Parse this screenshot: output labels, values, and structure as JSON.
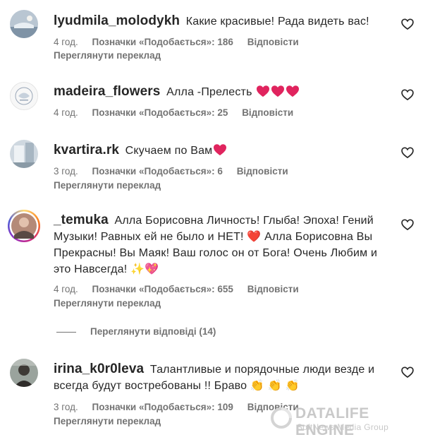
{
  "comments": [
    {
      "username": "lyudmila_molodykh",
      "text": "Какие красивые! Рада видеть вас!",
      "emojis": [],
      "time": "4 год.",
      "likes": "Позначки «Подобається»: 186",
      "reply": "Відповісти",
      "translation": "Переглянути переклад"
    },
    {
      "username": "madeira_flowers",
      "text": "Алла -Прелесть",
      "emojis": [
        "red-heart",
        "red-heart",
        "red-heart"
      ],
      "time": "4 год.",
      "likes": "Позначки «Подобається»: 25",
      "reply": "Відповісти",
      "translation": ""
    },
    {
      "username": "kvartira.rk",
      "text": "Скучаем по Вам",
      "emojis": [
        "red-heart"
      ],
      "time": "3 год.",
      "likes": "Позначки «Подобається»: 6",
      "reply": "Відповісти",
      "translation": "Переглянути переклад"
    },
    {
      "username": "_temuka",
      "text": "Алла Борисовна Личность! Глыба! Эпоха! Гений Музыки! Равных ей не было и НЕТ! ❤️ Алла Борисовна Вы Прекрасны! Вы Маяк! Ваш голос он от Бога! Очень Любим и это Навсегда! ✨💖",
      "emojis": [],
      "time": "4 год.",
      "likes": "Позначки «Подобається»: 655",
      "reply": "Відповісти",
      "translation": "Переглянути переклад"
    },
    {
      "username": "irina_k0r0leva",
      "text": "Талантливые и порядочные люди везде и всегда будут востребованы !! Браво 👏 👏 👏",
      "emojis": [],
      "time": "3 год.",
      "likes": "Позначки «Подобається»: 109",
      "reply": "Відповісти",
      "translation": "Переглянути переклад"
    }
  ],
  "view_replies": "Переглянути відповіді (14)",
  "watermark": {
    "title": "DATALIFE ENGINE",
    "subtitle": "SoftNews Media Group"
  },
  "colors": {
    "text": "#262626",
    "secondary": "#737373",
    "heart": "#e0245e",
    "story_ring": "#d62976"
  }
}
